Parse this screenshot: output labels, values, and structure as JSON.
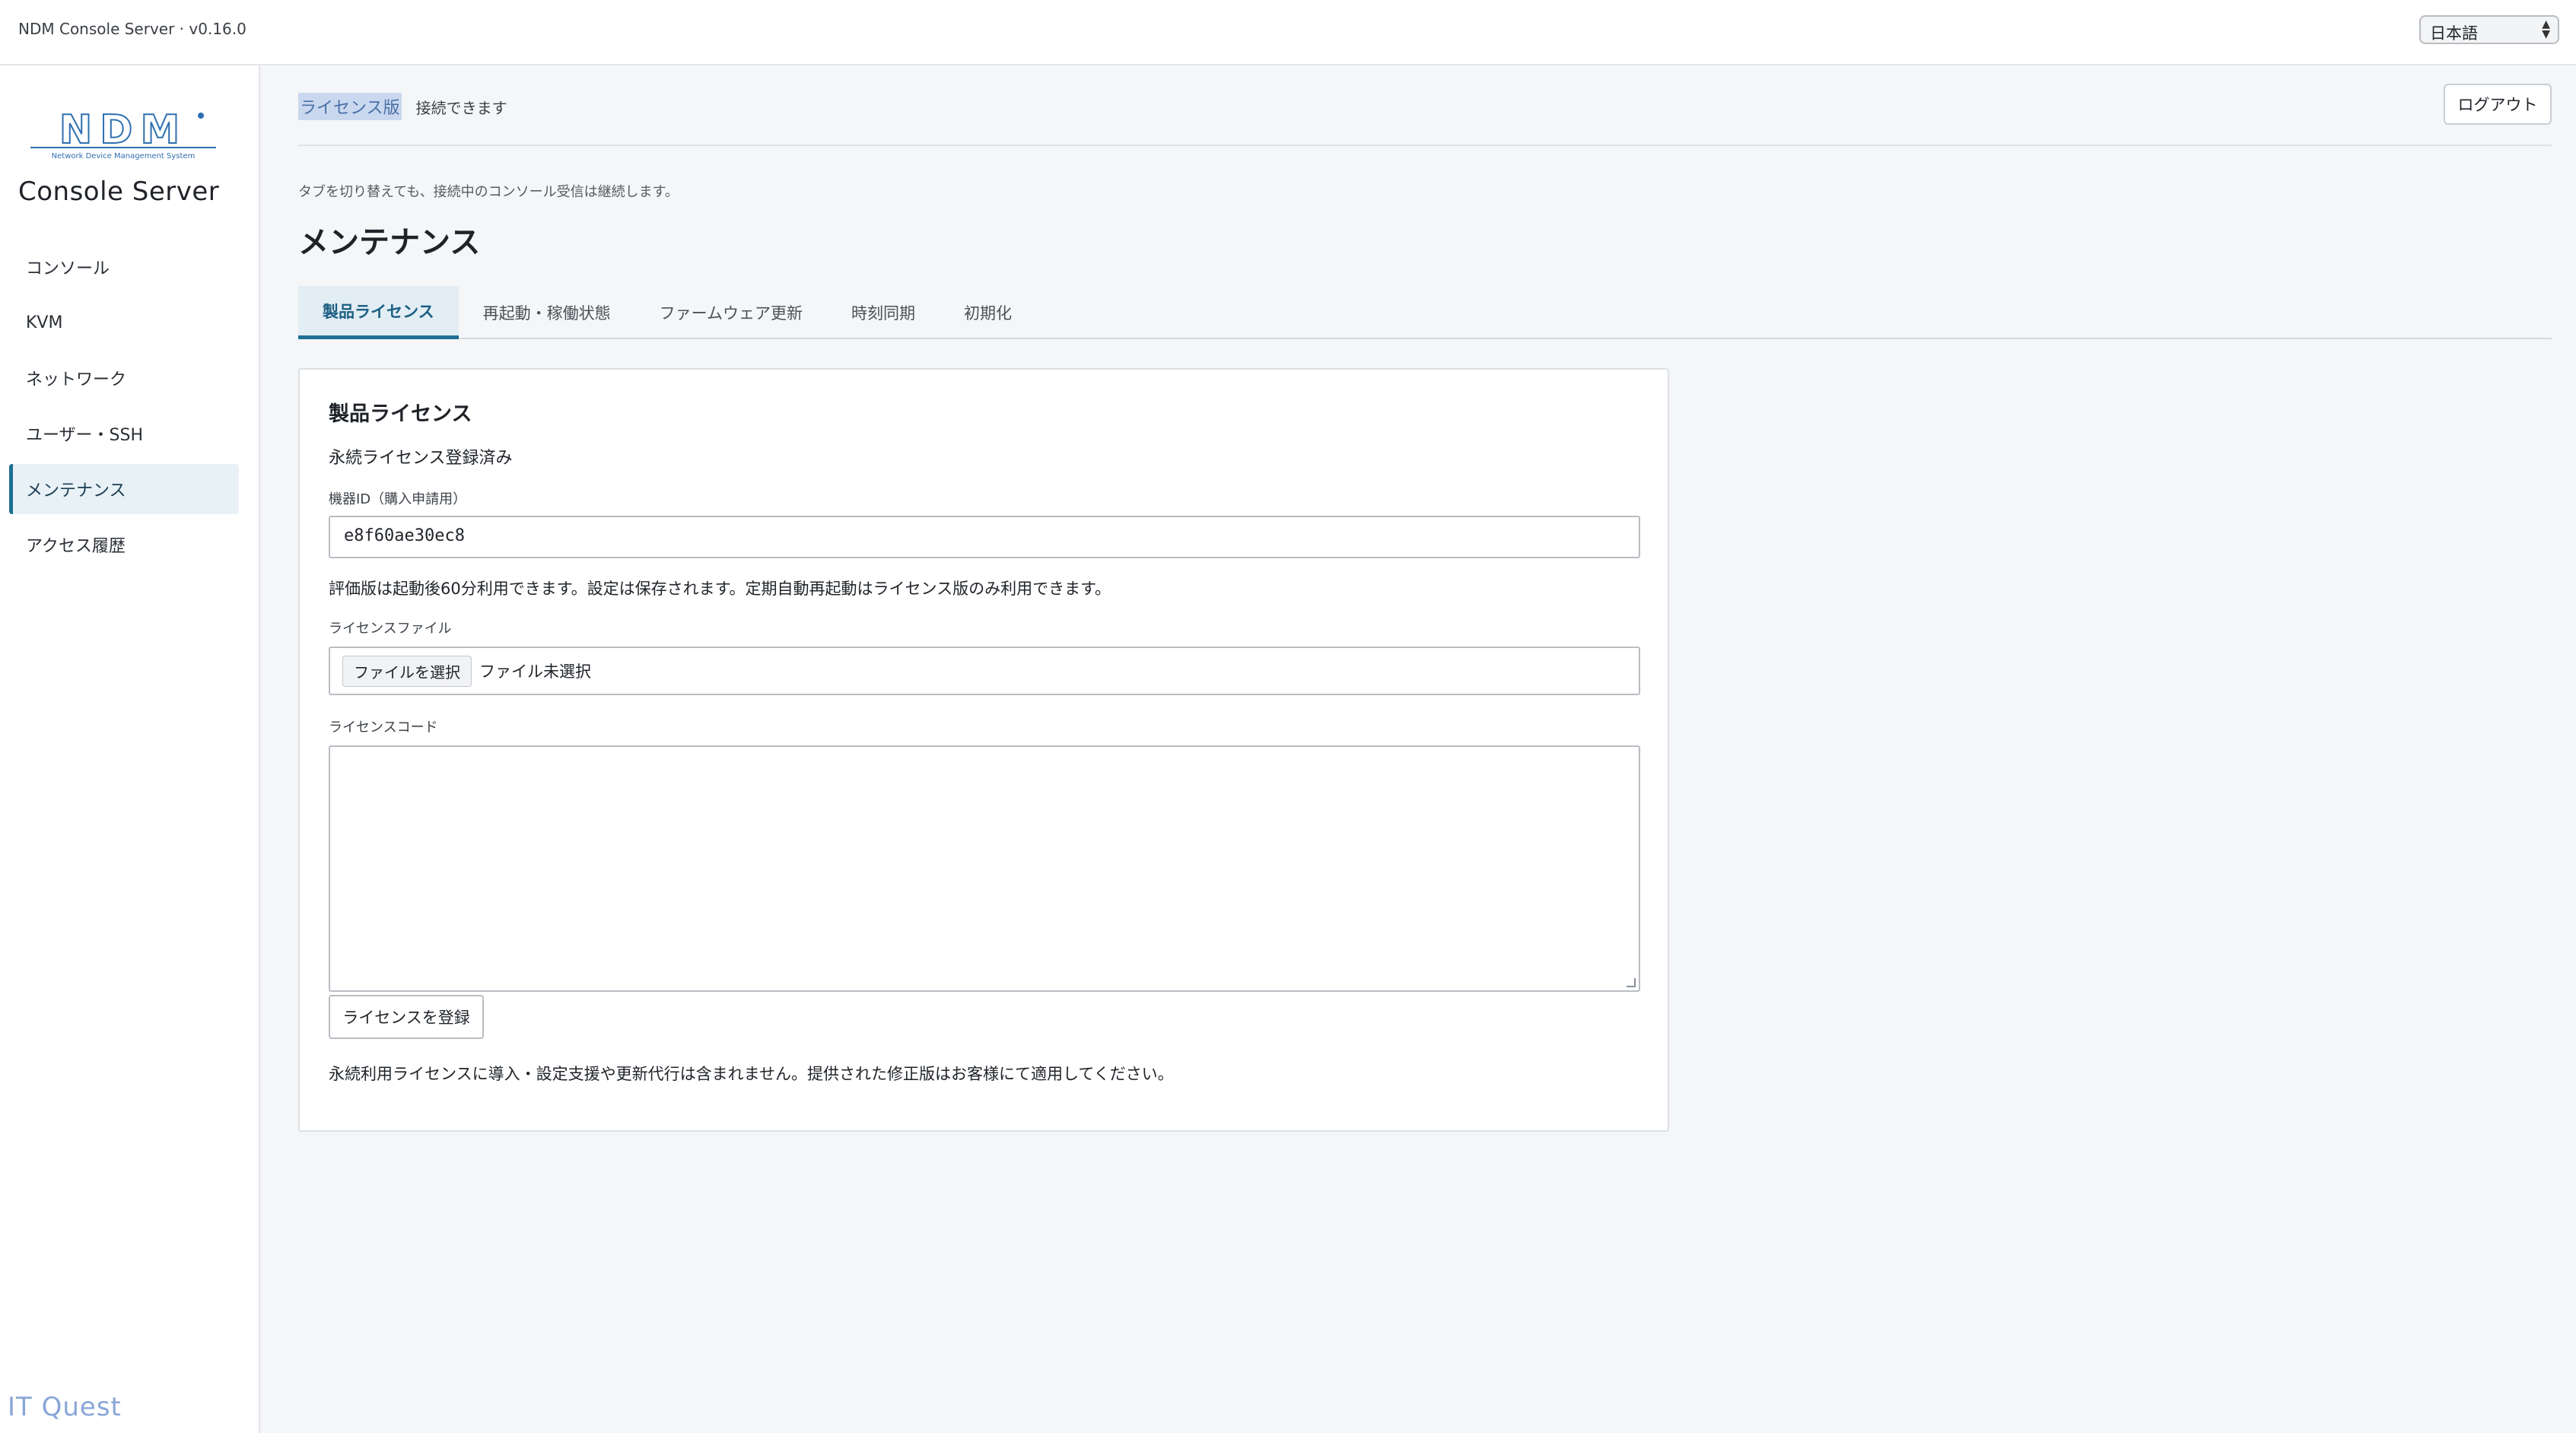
{
  "app": {
    "title": "NDM Console Server · v0.16.0",
    "language": "日本語"
  },
  "sidebar": {
    "logo_text": "NDM",
    "logo_subtext": "Network Device Management System",
    "product_name": "Console Server",
    "items": [
      {
        "label": "コンソール",
        "active": false
      },
      {
        "label": "KVM",
        "active": false
      },
      {
        "label": "ネットワーク",
        "active": false
      },
      {
        "label": "ユーザー・SSH",
        "active": false
      },
      {
        "label": "メンテナンス",
        "active": true
      },
      {
        "label": "アクセス履歴",
        "active": false
      }
    ],
    "footer_brand": "IT Quest"
  },
  "header": {
    "license_mode": "ライセンス版",
    "connection_status": "接続できます",
    "logout_label": "ログアウト"
  },
  "main": {
    "hint": "タブを切り替えても、接続中のコンソール受信は継続します。",
    "page_title": "メンテナンス",
    "tabs": [
      {
        "label": "製品ライセンス",
        "active": true
      },
      {
        "label": "再起動・稼働状態",
        "active": false
      },
      {
        "label": "ファームウェア更新",
        "active": false
      },
      {
        "label": "時刻同期",
        "active": false
      },
      {
        "label": "初期化",
        "active": false
      }
    ]
  },
  "license_card": {
    "title": "製品ライセンス",
    "state": "永続ライセンス登録済み",
    "device_id_label": "機器ID（購入申請用）",
    "device_id_value": "e8f60ae30ec8",
    "trial_note": "評価版は起動後60分利用できます。設定は保存されます。定期自動再起動はライセンス版のみ利用できます。",
    "file_label": "ライセンスファイル",
    "file_button": "ファイルを選択",
    "file_status": "ファイル未選択",
    "code_label": "ライセンスコード",
    "code_value": "",
    "register_label": "ライセンスを登録",
    "footnote": "永続利用ライセンスに導入・設定支援や更新代行は含まれません。提供された修正版はお客様にて適用してください。"
  }
}
